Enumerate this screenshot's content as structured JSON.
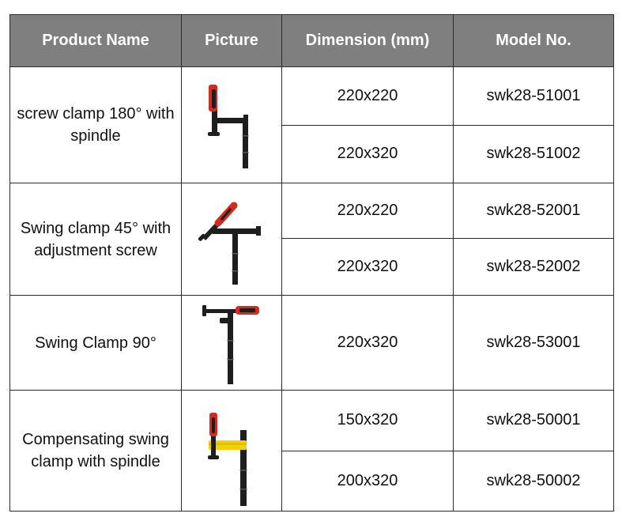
{
  "headers": {
    "product_name": "Product Name",
    "picture": "Picture",
    "dimension": "Dimension (mm)",
    "model_no": "Model No."
  },
  "products": [
    {
      "name": "screw clamp 180° with spindle",
      "icon": "screw-clamp-180-icon",
      "variants": [
        {
          "dimension": "220x220",
          "model": "swk28-51001"
        },
        {
          "dimension": "220x320",
          "model": "swk28-51002"
        }
      ]
    },
    {
      "name": "Swing clamp 45° with adjustment screw",
      "icon": "swing-clamp-45-icon",
      "variants": [
        {
          "dimension": "220x220",
          "model": "swk28-52001"
        },
        {
          "dimension": "220x320",
          "model": "swk28-52002"
        }
      ]
    },
    {
      "name": "Swing Clamp 90°",
      "icon": "swing-clamp-90-icon",
      "variants": [
        {
          "dimension": "220x320",
          "model": "swk28-53001"
        }
      ]
    },
    {
      "name": "Compensating swing clamp with spindle",
      "icon": "compensating-clamp-icon",
      "variants": [
        {
          "dimension": "150x320",
          "model": "swk28-50001"
        },
        {
          "dimension": "200x320",
          "model": "swk28-50002"
        }
      ]
    }
  ],
  "colors": {
    "header_bg": "#7f7f7f",
    "header_text": "#ffffff",
    "border": "#2b2b2b",
    "handle_red": "#d42a1f",
    "clamp_yellow": "#f2d200"
  }
}
